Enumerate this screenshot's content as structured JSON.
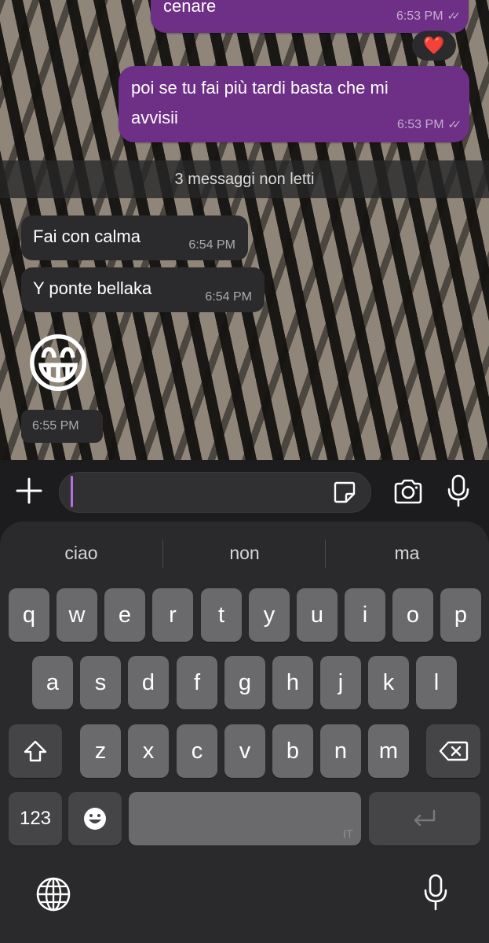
{
  "messages": {
    "out_partial_time": "6:53 PM",
    "out_partial_text": "cenare",
    "reaction": "❤️",
    "out2_text_line1": "poi se tu fai più tardi basta che mi",
    "out2_text_line2": "avvisii",
    "out2_time": "6:53 PM",
    "unread_label": "3 messaggi non letti",
    "in1_text": "Fai con calma",
    "in1_time": "6:54 PM",
    "in2_text": "Y ponte bellaka",
    "in2_time": "6:54 PM",
    "emoji": "😁",
    "emoji_time": "6:55 PM"
  },
  "input": {
    "placeholder": ""
  },
  "keyboard": {
    "suggestions": [
      "ciao",
      "non",
      "ma"
    ],
    "row1": [
      "q",
      "w",
      "e",
      "r",
      "t",
      "y",
      "u",
      "i",
      "o",
      "p"
    ],
    "row2": [
      "a",
      "s",
      "d",
      "f",
      "g",
      "h",
      "j",
      "k",
      "l"
    ],
    "row3": [
      "z",
      "x",
      "c",
      "v",
      "b",
      "n",
      "m"
    ],
    "numbers_label": "123",
    "language_label": "IT"
  },
  "colors": {
    "outgoing_bubble": "#6e2f86",
    "incoming_bubble": "#2b2b2d",
    "caret": "#b56ee0",
    "keyboard_bg": "#2a2a2c"
  },
  "icons": [
    "plus-icon",
    "sticker-icon",
    "camera-icon",
    "microphone-icon",
    "shift-icon",
    "backspace-icon",
    "emoji-icon",
    "return-icon",
    "globe-icon",
    "dictation-icon",
    "double-check-icon"
  ]
}
